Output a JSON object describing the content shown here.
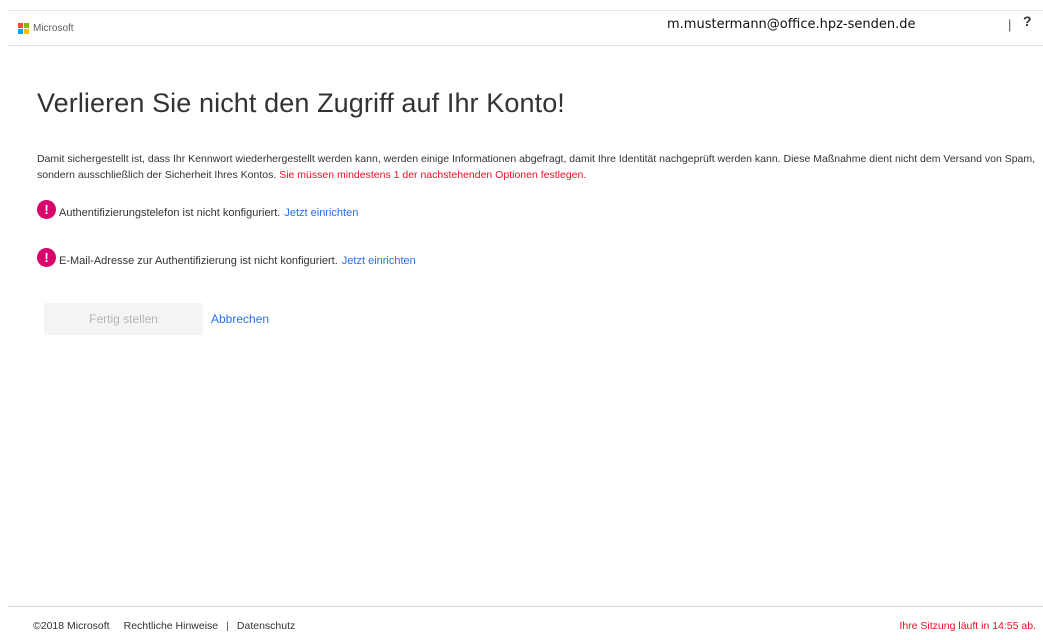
{
  "header": {
    "brand": "Microsoft",
    "brand_colors": [
      "#f25022",
      "#7fba00",
      "#00a4ef",
      "#ffb900"
    ],
    "user_email": "m.mustermann@office.hpz-senden.de",
    "separator": "|",
    "help_icon": "?"
  },
  "main": {
    "title": "Verlieren Sie nicht den Zugriff auf Ihr Konto!",
    "description": "Damit sichergestellt ist, dass Ihr Kennwort wiederhergestellt werden kann, werden einige Informationen abgefragt, damit Ihre Identität nachgeprüft werden kann. Diese Maßnahme dient nicht dem Versand von Spam, sondern ausschließlich der Sicherheit Ihres Kontos.",
    "requirement_warning": "Sie müssen mindestens 1 der nachstehenden Optionen festlegen.",
    "status_items": [
      {
        "icon": "alert-icon",
        "text": "Authentifizierungstelefon ist nicht konfiguriert.",
        "link": "Jetzt einrichten"
      },
      {
        "icon": "alert-icon",
        "text": "E-Mail-Adresse zur Authentifizierung ist nicht konfiguriert.",
        "link": "Jetzt einrichten"
      }
    ],
    "alert_glyph": "!",
    "finish_label": "Fertig stellen",
    "cancel_label": "Abbrechen"
  },
  "footer": {
    "copyright": "©2018 Microsoft",
    "legal_label": "Rechtliche Hinweise",
    "separator": "|",
    "privacy_label": "Datenschutz",
    "session_text": "Ihre Sitzung läuft in 14:55 ab."
  },
  "colors": {
    "alert": "#d9046a",
    "link": "#2672ec",
    "warning": "#e81123"
  }
}
